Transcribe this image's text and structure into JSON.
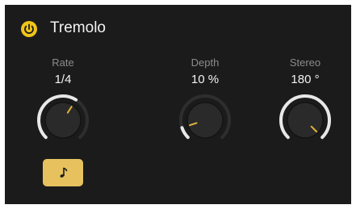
{
  "header": {
    "title": "Tremolo",
    "power_icon": "power-icon",
    "power_state": "on",
    "accent_color": "#f0c419"
  },
  "knobs": [
    {
      "id": "rate",
      "label": "Rate",
      "value": "1/4",
      "level": 0.62
    },
    {
      "id": "depth",
      "label": "Depth",
      "value": "10 %",
      "level": 0.1
    },
    {
      "id": "stereo",
      "label": "Stereo",
      "value": "180 °",
      "level": 1.0
    }
  ],
  "sync_button": {
    "icon": "music-note-icon",
    "active": true,
    "color": "#e6c15e"
  },
  "colors": {
    "background": "#1b1b1b",
    "label": "#8c8c8c",
    "value": "#f2f2f2",
    "arc_filled": "#e8e8e8",
    "arc_track": "#2e2e2e",
    "pointer": "#e0b33a"
  }
}
